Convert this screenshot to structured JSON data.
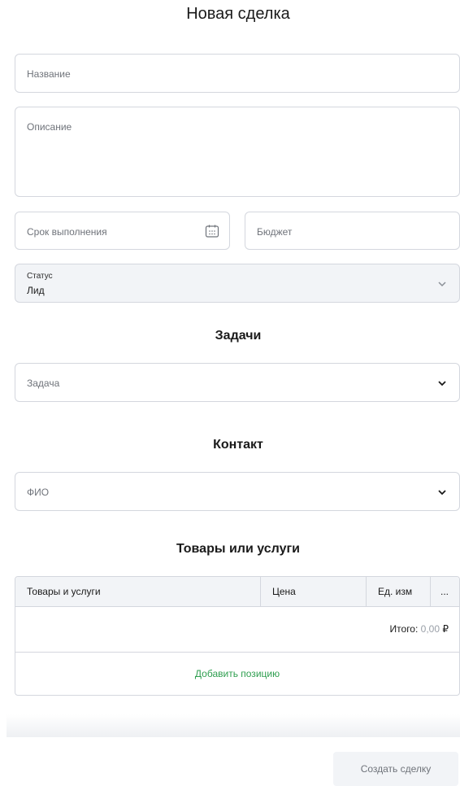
{
  "title": "Новая сделка",
  "fields": {
    "name_placeholder": "Название",
    "description_placeholder": "Описание",
    "deadline_placeholder": "Срок выполнения",
    "budget_placeholder": "Бюджет",
    "status_label": "Статус",
    "status_value": "Лид"
  },
  "tasks": {
    "heading": "Задачи",
    "task_placeholder": "Задача"
  },
  "contact": {
    "heading": "Контакт",
    "fio_placeholder": "ФИО"
  },
  "goods": {
    "heading": "Товары или услуги",
    "columns": [
      "Товары и услуги",
      "Цена",
      "Ед. изм",
      "..."
    ],
    "total_label": "Итого:",
    "total_amount": "0,00",
    "currency": "₽",
    "add_label": "Добавить позицию"
  },
  "footer": {
    "create_label": "Создать сделку"
  },
  "icons": {
    "calendar": "calendar-icon",
    "chevron": "chevron-down-icon"
  },
  "colors": {
    "accent_green": "#2e9e4f",
    "border": "#d4d7de",
    "muted_bg": "#f2f4f7"
  }
}
